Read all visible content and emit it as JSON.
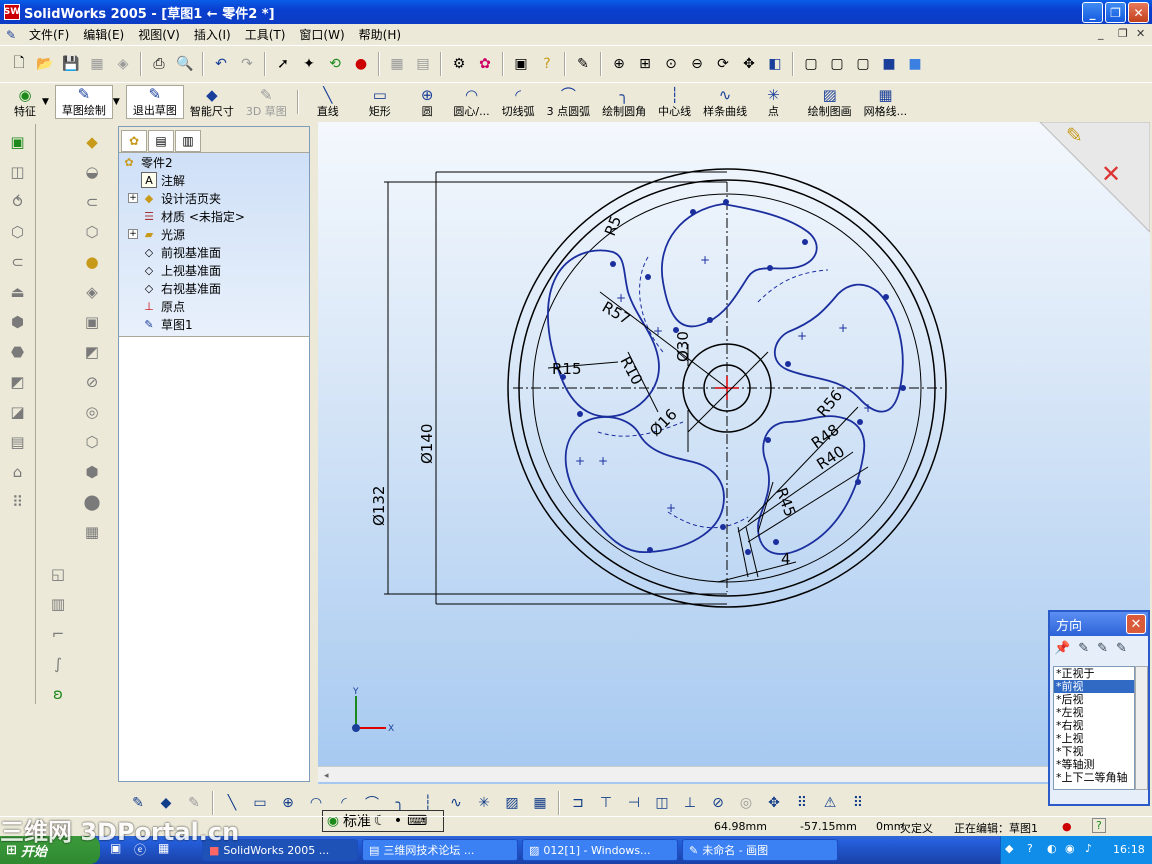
{
  "window": {
    "title": "SolidWorks 2005 - [草图1 ← 零件2 *]",
    "app_icon": "SW"
  },
  "menu": {
    "items": [
      "文件(F)",
      "编辑(E)",
      "视图(V)",
      "插入(I)",
      "工具(T)",
      "窗口(W)",
      "帮助(H)"
    ]
  },
  "sketch_toolbar": {
    "items": [
      {
        "label": "特征",
        "icon": "features-icon"
      },
      {
        "label": "草图绘制",
        "icon": "sketch-icon"
      },
      {
        "label": "退出草图",
        "icon": "exit-sketch-icon"
      },
      {
        "label": "智能尺寸",
        "icon": "smart-dimension-icon"
      },
      {
        "label": "3D 草图",
        "icon": "3d-sketch-icon"
      },
      {
        "label": "直线",
        "icon": "line-icon"
      },
      {
        "label": "矩形",
        "icon": "rectangle-icon"
      },
      {
        "label": "圆",
        "icon": "circle-icon"
      },
      {
        "label": "圆心/...",
        "icon": "centerpoint-arc-icon"
      },
      {
        "label": "切线弧",
        "icon": "tangent-arc-icon"
      },
      {
        "label": "3 点圆弧",
        "icon": "three-point-arc-icon"
      },
      {
        "label": "绘制圆角",
        "icon": "sketch-fillet-icon"
      },
      {
        "label": "中心线",
        "icon": "centerline-icon"
      },
      {
        "label": "样条曲线",
        "icon": "spline-icon"
      },
      {
        "label": "点",
        "icon": "point-icon"
      },
      {
        "label": "绘制图画",
        "icon": "sketch-picture-icon"
      },
      {
        "label": "网格线...",
        "icon": "grid-icon"
      }
    ]
  },
  "feature_tree": {
    "root": "零件2",
    "nodes": [
      "注解",
      "设计活页夹",
      "材质 <未指定>",
      "光源",
      "前视基准面",
      "上视基准面",
      "右视基准面",
      "原点",
      "草图1"
    ]
  },
  "drawing": {
    "dimensions": [
      "R5",
      "R57",
      "R15",
      "R10",
      "Ø30",
      "Ø16",
      "Ø140",
      "Ø132",
      "R56",
      "R48",
      "R40",
      "R45",
      "4"
    ],
    "axis_x": "X",
    "axis_y": "Y"
  },
  "orientation_panel": {
    "title": "方向",
    "items": [
      "*正视于",
      "*前视",
      "*后视",
      "*左视",
      "*右视",
      "*上视",
      "*下视",
      "*等轴测",
      "*上下二等角轴"
    ],
    "selected_index": 1
  },
  "ime": {
    "label": "标准"
  },
  "status": {
    "x": "64.98mm",
    "y": "-57.15mm",
    "z": "0mm",
    "state": "欠定义",
    "editing": "正在编辑：草图1"
  },
  "taskbar": {
    "start": "开始",
    "tasks": [
      "SolidWorks 2005 ...",
      "三维网技术论坛 ...",
      "012[1] - Windows...",
      "未命名 - 画图"
    ],
    "clock": "16:18"
  },
  "watermark": "三维网 3DPortal.cn"
}
